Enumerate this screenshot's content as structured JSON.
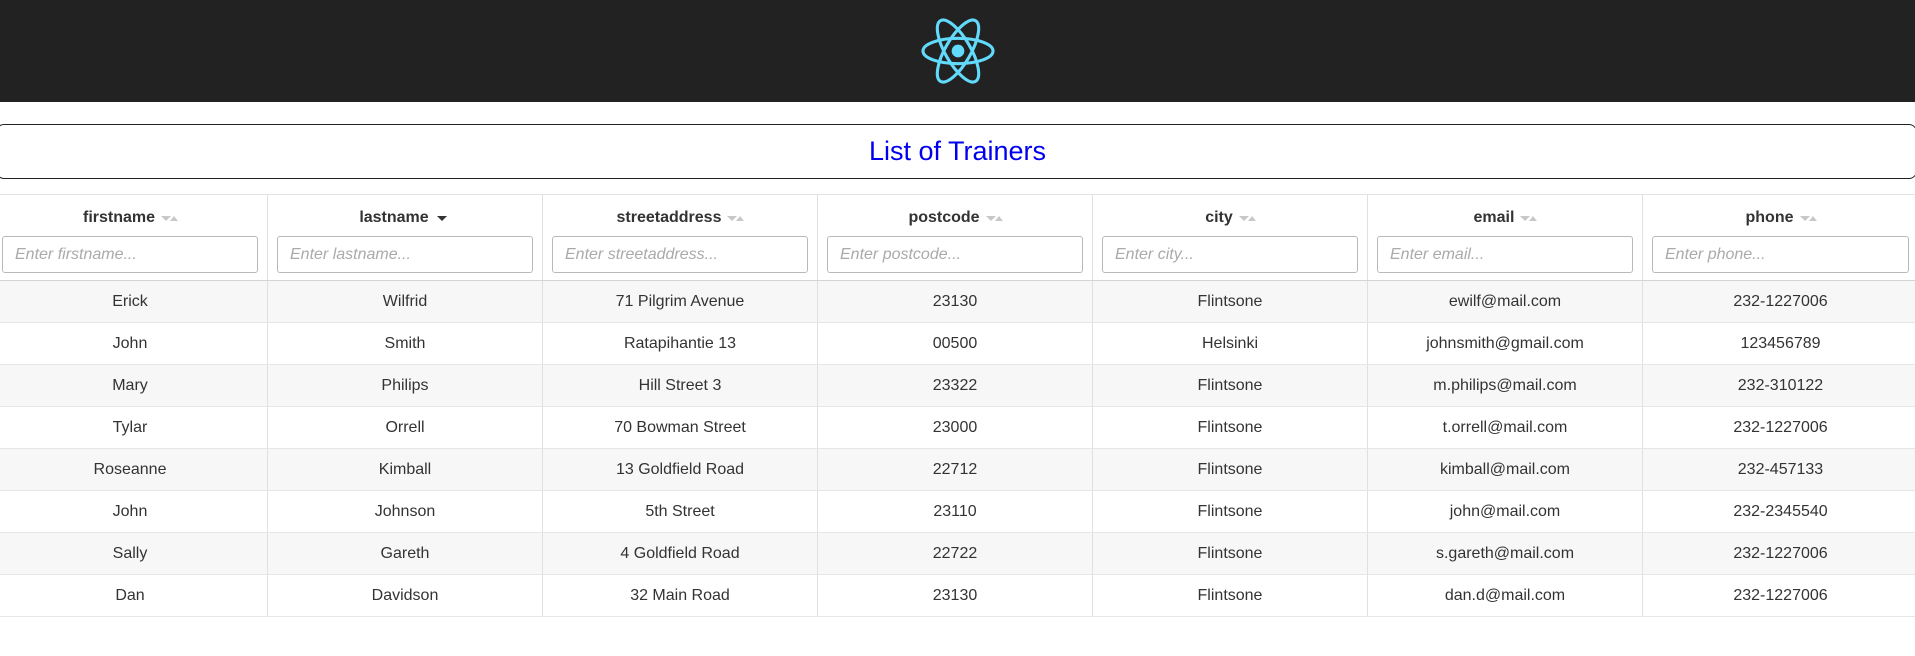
{
  "header": {
    "logo_icon": "react-logo-icon",
    "logo_color": "#61dafb",
    "background": "#222222"
  },
  "page": {
    "title": "List of Trainers",
    "title_color": "#0000ee"
  },
  "table": {
    "columns": [
      {
        "label": "firstname",
        "placeholder": "Enter firstname...",
        "sort": "none"
      },
      {
        "label": "lastname",
        "placeholder": "Enter lastname...",
        "sort": "asc"
      },
      {
        "label": "streetaddress",
        "placeholder": "Enter streetaddress...",
        "sort": "none"
      },
      {
        "label": "postcode",
        "placeholder": "Enter postcode...",
        "sort": "none"
      },
      {
        "label": "city",
        "placeholder": "Enter city...",
        "sort": "none"
      },
      {
        "label": "email",
        "placeholder": "Enter email...",
        "sort": "none"
      },
      {
        "label": "phone",
        "placeholder": "Enter phone...",
        "sort": "none"
      }
    ],
    "rows": [
      [
        "Erick",
        "Wilfrid",
        "71 Pilgrim Avenue",
        "23130",
        "Flintsone",
        "ewilf@mail.com",
        "232-1227006"
      ],
      [
        "John",
        "Smith",
        "Ratapihantie 13",
        "00500",
        "Helsinki",
        "johnsmith@gmail.com",
        "123456789"
      ],
      [
        "Mary",
        "Philips",
        "Hill Street 3",
        "23322",
        "Flintsone",
        "m.philips@mail.com",
        "232-310122"
      ],
      [
        "Tylar",
        "Orrell",
        "70 Bowman Street",
        "23000",
        "Flintsone",
        "t.orrell@mail.com",
        "232-1227006"
      ],
      [
        "Roseanne",
        "Kimball",
        "13 Goldfield Road",
        "22712",
        "Flintsone",
        "kimball@mail.com",
        "232-457133"
      ],
      [
        "John",
        "Johnson",
        "5th Street",
        "23110",
        "Flintsone",
        "john@mail.com",
        "232-2345540"
      ],
      [
        "Sally",
        "Gareth",
        "4 Goldfield Road",
        "22722",
        "Flintsone",
        "s.gareth@mail.com",
        "232-1227006"
      ],
      [
        "Dan",
        "Davidson",
        "32 Main Road",
        "23130",
        "Flintsone",
        "dan.d@mail.com",
        "232-1227006"
      ]
    ]
  }
}
